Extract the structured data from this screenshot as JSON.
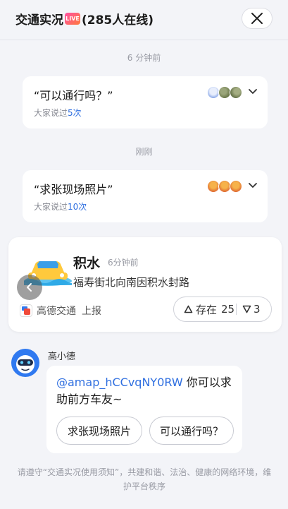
{
  "header": {
    "title": "交通实况",
    "live_badge": "LIVE",
    "online": "(285人在线)"
  },
  "feed": [
    {
      "time": "6 分钟前",
      "question": "“可以通行吗？”",
      "sub_prefix": "大家说过",
      "count": "5次"
    },
    {
      "time": "刚刚",
      "question": "“求张现场照片”",
      "sub_prefix": "大家说过",
      "count": "10次"
    }
  ],
  "incident": {
    "title": "积水",
    "time": "6分钟前",
    "description": "福寿街北向南因积水封路",
    "source": "高德交通",
    "source_action": "上报",
    "exists_label": "存在",
    "exists_count": "25",
    "not_exists_count": "3"
  },
  "bot": {
    "name": "高小德",
    "mention": "@amap_hCCvqNY0RW",
    "message": " 你可以求助前方车友~",
    "chips": [
      "求张现场照片",
      "可以通行吗？"
    ]
  },
  "footer_text": "请遵守“交通实况使用须知”，共建和谐、法治、健康的网络环境，维护平台秩序",
  "colors": {
    "accent": "#2f6fe0",
    "background": "#f3f4f8",
    "live_gradient_start": "#ff4fa3",
    "live_gradient_end": "#ff7a3c"
  }
}
